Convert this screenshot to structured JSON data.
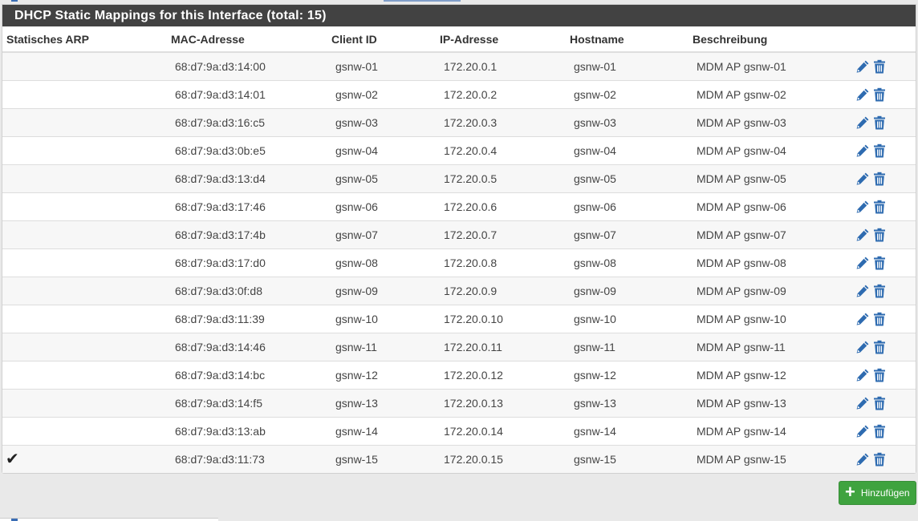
{
  "panel": {
    "title": "DHCP Static Mappings for this Interface (total: 15)"
  },
  "table": {
    "headers": {
      "arp": "Statisches ARP",
      "mac": "MAC-Adresse",
      "client_id": "Client ID",
      "ip": "IP-Adresse",
      "hostname": "Hostname",
      "description": "Beschreibung"
    },
    "rows": [
      {
        "arp": "",
        "mac": "68:d7:9a:d3:14:00",
        "client_id": "gsnw-01",
        "ip": "172.20.0.1",
        "hostname": "gsnw-01",
        "description": "MDM AP gsnw-01"
      },
      {
        "arp": "",
        "mac": "68:d7:9a:d3:14:01",
        "client_id": "gsnw-02",
        "ip": "172.20.0.2",
        "hostname": "gsnw-02",
        "description": "MDM AP gsnw-02"
      },
      {
        "arp": "",
        "mac": "68:d7:9a:d3:16:c5",
        "client_id": "gsnw-03",
        "ip": "172.20.0.3",
        "hostname": "gsnw-03",
        "description": "MDM AP gsnw-03"
      },
      {
        "arp": "",
        "mac": "68:d7:9a:d3:0b:e5",
        "client_id": "gsnw-04",
        "ip": "172.20.0.4",
        "hostname": "gsnw-04",
        "description": "MDM AP gsnw-04"
      },
      {
        "arp": "",
        "mac": "68:d7:9a:d3:13:d4",
        "client_id": "gsnw-05",
        "ip": "172.20.0.5",
        "hostname": "gsnw-05",
        "description": "MDM AP gsnw-05"
      },
      {
        "arp": "",
        "mac": "68:d7:9a:d3:17:46",
        "client_id": "gsnw-06",
        "ip": "172.20.0.6",
        "hostname": "gsnw-06",
        "description": "MDM AP gsnw-06"
      },
      {
        "arp": "",
        "mac": "68:d7:9a:d3:17:4b",
        "client_id": "gsnw-07",
        "ip": "172.20.0.7",
        "hostname": "gsnw-07",
        "description": "MDM AP gsnw-07"
      },
      {
        "arp": "",
        "mac": "68:d7:9a:d3:17:d0",
        "client_id": "gsnw-08",
        "ip": "172.20.0.8",
        "hostname": "gsnw-08",
        "description": "MDM AP gsnw-08"
      },
      {
        "arp": "",
        "mac": "68:d7:9a:d3:0f:d8",
        "client_id": "gsnw-09",
        "ip": "172.20.0.9",
        "hostname": "gsnw-09",
        "description": "MDM AP gsnw-09"
      },
      {
        "arp": "",
        "mac": "68:d7:9a:d3:11:39",
        "client_id": "gsnw-10",
        "ip": "172.20.0.10",
        "hostname": "gsnw-10",
        "description": "MDM AP gsnw-10"
      },
      {
        "arp": "",
        "mac": "68:d7:9a:d3:14:46",
        "client_id": "gsnw-11",
        "ip": "172.20.0.11",
        "hostname": "gsnw-11",
        "description": "MDM AP gsnw-11"
      },
      {
        "arp": "",
        "mac": "68:d7:9a:d3:14:bc",
        "client_id": "gsnw-12",
        "ip": "172.20.0.12",
        "hostname": "gsnw-12",
        "description": "MDM AP gsnw-12"
      },
      {
        "arp": "",
        "mac": "68:d7:9a:d3:14:f5",
        "client_id": "gsnw-13",
        "ip": "172.20.0.13",
        "hostname": "gsnw-13",
        "description": "MDM AP gsnw-13"
      },
      {
        "arp": "",
        "mac": "68:d7:9a:d3:13:ab",
        "client_id": "gsnw-14",
        "ip": "172.20.0.14",
        "hostname": "gsnw-14",
        "description": "MDM AP gsnw-14"
      },
      {
        "arp": "✔",
        "mac": "68:d7:9a:d3:11:73",
        "client_id": "gsnw-15",
        "ip": "172.20.0.15",
        "hostname": "gsnw-15",
        "description": "MDM AP gsnw-15"
      }
    ],
    "row_actions": [
      "pencil-icon",
      "trash-icon"
    ]
  },
  "actions": {
    "add_label": "Hinzufügen",
    "add_icon": "plus-icon"
  },
  "colors": {
    "heading_bg": "#424242",
    "icon_blue": "#2e6bb0",
    "add_green": "#3fa33f"
  }
}
